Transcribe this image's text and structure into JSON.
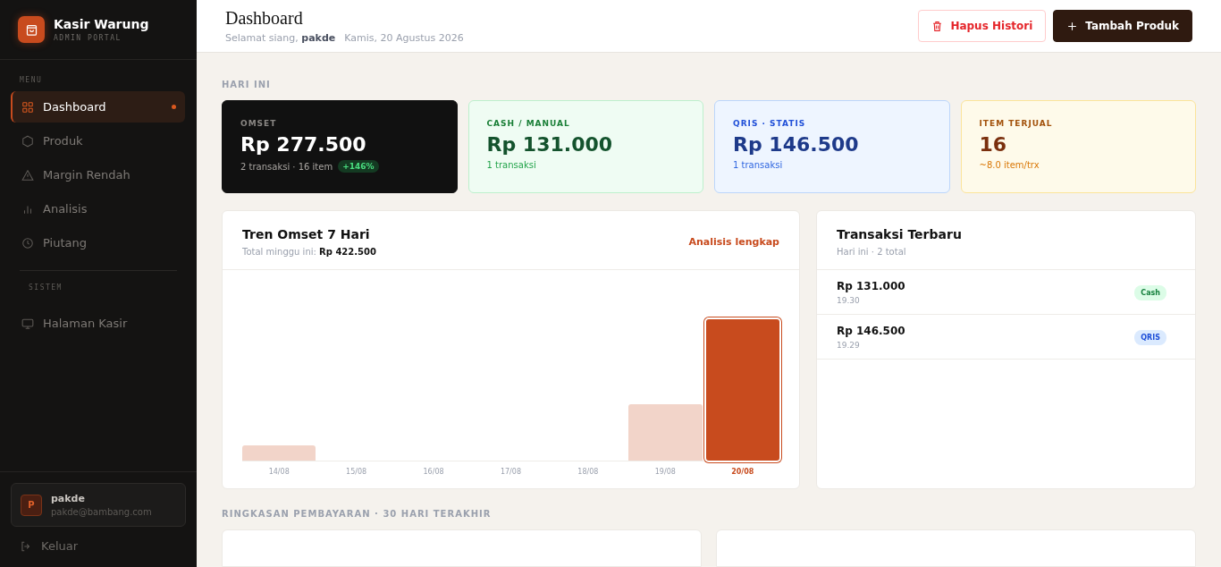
{
  "brand": {
    "name": "Kasir Warung",
    "subtitle": "ADMIN PORTAL"
  },
  "sidebar": {
    "sections": [
      {
        "heading": "MENU",
        "items": [
          {
            "label": "Dashboard",
            "kind": "grid",
            "selected": true
          },
          {
            "label": "Produk",
            "kind": "hexagon",
            "selected": false
          },
          {
            "label": "Margin Rendah",
            "kind": "warning",
            "selected": false
          },
          {
            "label": "Analisis",
            "kind": "bars",
            "selected": false
          },
          {
            "label": "Piutang",
            "kind": "clock",
            "selected": false
          }
        ]
      },
      {
        "heading": "SISTEM",
        "items": [
          {
            "label": "Halaman Kasir",
            "kind": "monitor",
            "selected": false
          }
        ]
      }
    ],
    "user": {
      "initial": "P",
      "name": "pakde",
      "email": "pakde@bambang.com"
    },
    "logout": "Keluar"
  },
  "header": {
    "title": "Dashboard",
    "greeting": "Selamat siang, **pakde**",
    "date": "Kamis, 20 Agustus 2026",
    "buttons": [
      {
        "label": "Hapus Histori",
        "kind": "danger"
      },
      {
        "label": "Tambah Produk",
        "kind": "primary"
      }
    ]
  },
  "today": {
    "heading": "HARI INI",
    "cards": [
      {
        "kind": "dark",
        "label": "OMSET",
        "value": "Rp 277.500",
        "note": "2 transaksi · 16 item",
        "badge": "+146%"
      },
      {
        "kind": "green",
        "label": "CASH / MANUAL",
        "value": "Rp 131.000",
        "note": "1 transaksi"
      },
      {
        "kind": "blue",
        "label": "QRIS · STATIS",
        "value": "Rp 146.500",
        "note": "1 transaksi"
      },
      {
        "kind": "yellow",
        "label": "ITEM TERJUAL",
        "value": "16",
        "note": "~8.0 item/trx"
      }
    ]
  },
  "trend": {
    "title": "Tren Omset 7 Hari",
    "subtitle": "Total minggu ini: **Rp 422.500**",
    "link": "Analisis lengkap",
    "days": [
      {
        "label": "14/08",
        "selected": false
      },
      {
        "label": "15/08",
        "selected": false
      },
      {
        "label": "16/08",
        "selected": false
      },
      {
        "label": "17/08",
        "selected": false
      },
      {
        "label": "18/08",
        "selected": false
      },
      {
        "label": "19/08",
        "selected": false
      },
      {
        "label": "20/08",
        "selected": true
      }
    ]
  },
  "transactions": {
    "title": "Transaksi Terbaru",
    "subtitle": "Hari ini · 2 total",
    "rows": [
      {
        "amount": "Rp 131.000",
        "time": "19.30",
        "method": "Cash",
        "kind": "cash"
      },
      {
        "amount": "Rp 146.500",
        "time": "19.29",
        "method": "QRIS",
        "kind": "qris"
      }
    ]
  },
  "payment_summary": {
    "heading": "RINGKASAN PEMBAYARAN · 30 HARI TERAKHIR"
  }
}
